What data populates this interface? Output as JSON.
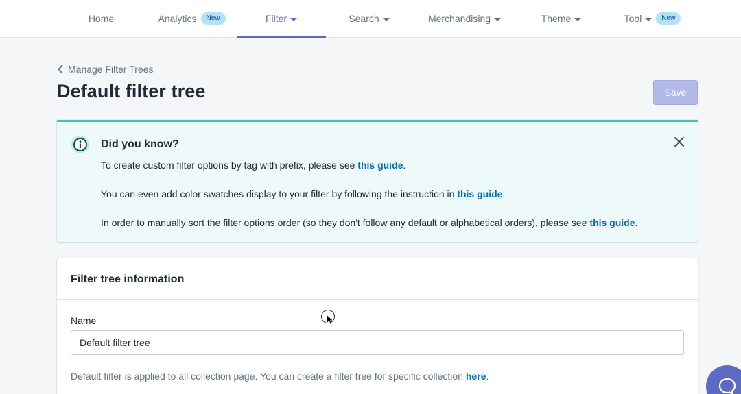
{
  "nav": {
    "items": [
      {
        "label": "Home",
        "dropdown": false,
        "badge": ""
      },
      {
        "label": "Analytics",
        "dropdown": false,
        "badge": "New"
      },
      {
        "label": "Filter",
        "dropdown": true,
        "badge": "",
        "active": true
      },
      {
        "label": "Search",
        "dropdown": true,
        "badge": ""
      },
      {
        "label": "Merchandising",
        "dropdown": true,
        "badge": ""
      },
      {
        "label": "Theme",
        "dropdown": true,
        "badge": ""
      },
      {
        "label": "Tool",
        "dropdown": true,
        "badge": "New"
      }
    ]
  },
  "breadcrumb": {
    "label": "Manage Filter Trees"
  },
  "header": {
    "title": "Default filter tree",
    "save_label": "Save"
  },
  "banner": {
    "title": "Did you know?",
    "lines": [
      {
        "text": "To create custom filter options by tag with prefix, please see ",
        "link": "this guide",
        "suffix": "."
      },
      {
        "text": "You can even add color swatches display to your filter by following the instruction in ",
        "link": "this guide",
        "suffix": "."
      },
      {
        "text": "In order to manually sort the filter options order (so they don't follow any default or alphabetical orders), please see ",
        "link": "this guide",
        "suffix": "."
      }
    ]
  },
  "card": {
    "title": "Filter tree information",
    "name_label": "Name",
    "name_value": "Default filter tree",
    "help_text": "Default filter is applied to all collection page. You can create a filter tree for specific collection ",
    "help_link": "here",
    "help_suffix": "."
  },
  "colors": {
    "accent": "#5c6ac4",
    "link": "#006fbb",
    "banner_bg": "#eef9f9",
    "banner_border": "#47c1bf",
    "badge_bg": "#b4e1fa"
  },
  "icons": {
    "breadcrumb": "chevron-left-icon",
    "banner": "info-icon",
    "banner_close": "close-icon",
    "chat": "chat-icon"
  }
}
